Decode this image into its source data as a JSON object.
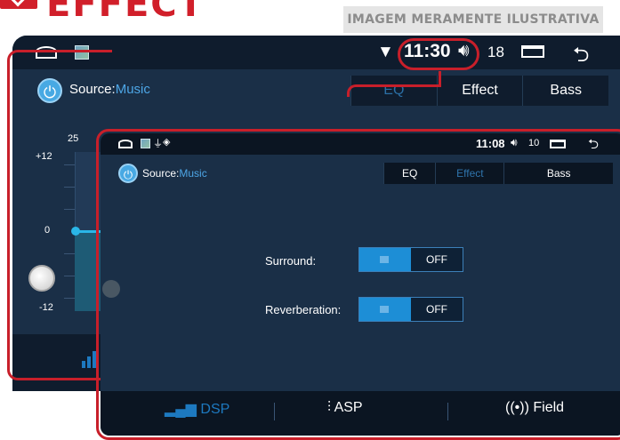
{
  "brand": {
    "title": "EFFECT",
    "disclaimer": "IMAGEM MERAMENTE ILUSTRATIVA"
  },
  "background_screen": {
    "status": {
      "time": "11:30",
      "volume": "18"
    },
    "source_label": "Source:",
    "source_value": "Music",
    "tabs": [
      {
        "label": "EQ"
      },
      {
        "label": "Effect"
      },
      {
        "label": "Bass"
      }
    ],
    "eq": {
      "top_value": "25",
      "plus_label": "+12",
      "zero_label": "0",
      "minus_label": "-12"
    }
  },
  "front_screen": {
    "status": {
      "time": "11:08",
      "volume": "10"
    },
    "source_label": "Source:",
    "source_value": "Music",
    "tabs": [
      {
        "label": "EQ"
      },
      {
        "label": "Effect"
      },
      {
        "label": "Bass"
      }
    ],
    "settings": [
      {
        "label": "Surround:",
        "state": "OFF"
      },
      {
        "label": "Reverberation:",
        "state": "OFF"
      }
    ],
    "bottom_nav": [
      {
        "label": "DSP"
      },
      {
        "label": "ASP"
      },
      {
        "label": "Field"
      }
    ]
  },
  "colors": {
    "accent_red": "#c81f2a",
    "screen_bg": "#1a2f47",
    "active_blue": "#1d8ed6"
  }
}
